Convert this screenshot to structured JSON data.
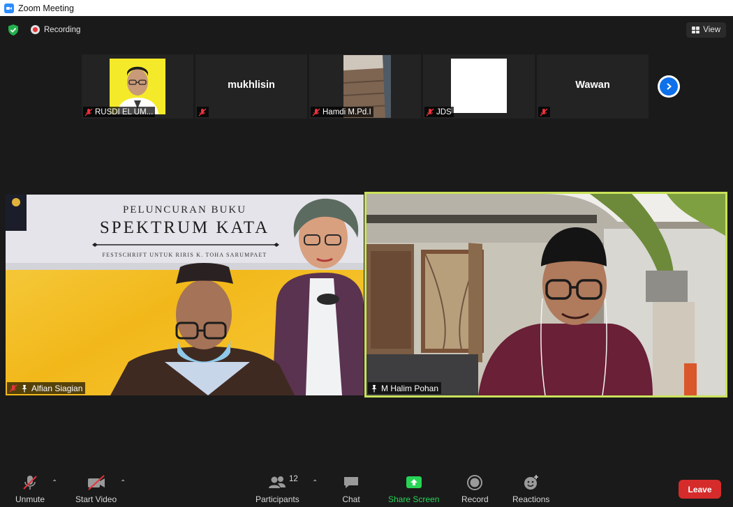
{
  "window": {
    "title": "Zoom Meeting"
  },
  "topbar": {
    "recording_label": "Recording",
    "view_label": "View"
  },
  "strip": {
    "tiles": [
      {
        "name": "RUSDI EL UM...",
        "kind": "video"
      },
      {
        "name": "mukhlisin",
        "kind": "name"
      },
      {
        "name": "Hamdi M.Pd.I",
        "kind": "video"
      },
      {
        "name": "JDS",
        "kind": "video"
      },
      {
        "name": "Wawan",
        "kind": "name"
      }
    ],
    "center_names": {
      "mukhlisin": "mukhlisin",
      "wawan": "Wawan"
    }
  },
  "videos": {
    "left": {
      "name": "Alfian Siagian",
      "banner": {
        "line1": "PELUNCURAN BUKU",
        "line2": "SPEKTRUM KATA",
        "line3": "FESTSCHRIFT UNTUK RIRIS K. TOHA SARUMPAET"
      }
    },
    "right": {
      "name": "M Halim Pohan"
    }
  },
  "toolbar": {
    "unmute": "Unmute",
    "start_video": "Start Video",
    "participants": "Participants",
    "participants_count": "12",
    "chat": "Chat",
    "share_screen": "Share Screen",
    "record": "Record",
    "reactions": "Reactions",
    "leave": "Leave"
  },
  "colors": {
    "accent": "#2d8cff",
    "active_speaker_border": "#c9e25a",
    "share_green": "#27d455",
    "leave_red": "#d62b2b",
    "mute_red": "#e8333a"
  }
}
